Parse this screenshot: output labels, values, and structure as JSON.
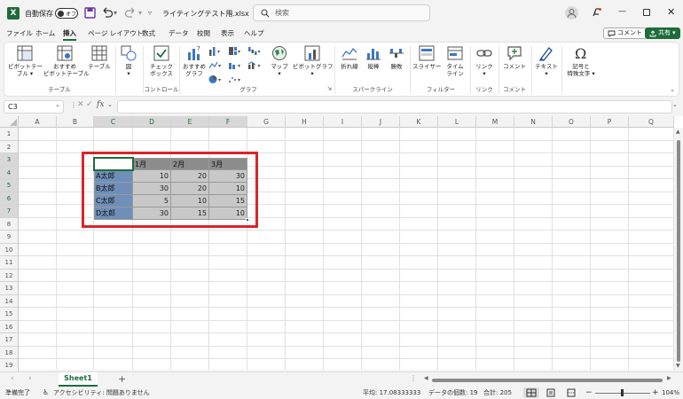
{
  "titlebar": {
    "autosave_label": "自動保存",
    "autosave_state": "オフ",
    "filename": "ライティングテスト用.xlsx",
    "search_placeholder": "検索"
  },
  "menu": {
    "items": [
      "ファイル",
      "ホーム",
      "挿入",
      "ページ レイアウト",
      "数式",
      "データ",
      "校閲",
      "表示",
      "ヘルプ"
    ],
    "active": "挿入",
    "comment_button": "コメント",
    "share_button": "共有"
  },
  "ribbon": {
    "buttons": [
      {
        "label": "ピボットテー\nブル ▾",
        "icon": "pivot-table-icon"
      },
      {
        "label": "おすすめ\nピボットテーブル",
        "icon": "recommended-pivot-icon"
      },
      {
        "label": "テーブル",
        "icon": "table-icon"
      },
      {
        "label": "図\n▾",
        "icon": "illustrations-icon"
      },
      {
        "label": "チェック\nボックス",
        "icon": "checkbox-icon"
      },
      {
        "label": "おすすめ\nグラフ",
        "icon": "recommended-chart-icon"
      },
      {
        "label": "マップ\n▾",
        "icon": "map-icon"
      },
      {
        "label": "ピボットグラフ\n▾",
        "icon": "pivot-chart-icon"
      },
      {
        "label": "折れ線",
        "icon": "sparkline-line-icon"
      },
      {
        "label": "縦棒",
        "icon": "sparkline-column-icon"
      },
      {
        "label": "勝敗",
        "icon": "sparkline-winloss-icon"
      },
      {
        "label": "スライサー",
        "icon": "slicer-icon"
      },
      {
        "label": "タイム\nライン",
        "icon": "timeline-icon"
      },
      {
        "label": "リンク\n▾",
        "icon": "link-icon"
      },
      {
        "label": "コメント",
        "icon": "comment-icon"
      },
      {
        "label": "テキスト\n▾",
        "icon": "text-icon"
      },
      {
        "label": "記号と\n特殊文字 ▾",
        "icon": "symbol-icon"
      }
    ],
    "groups": [
      "テーブル",
      "コントロール",
      "グラフ",
      "スパークライン",
      "フィルター",
      "リンク",
      "コメント"
    ]
  },
  "formula_bar": {
    "name_box": "C3",
    "formula": ""
  },
  "columns": [
    "A",
    "B",
    "C",
    "D",
    "E",
    "F",
    "G",
    "H",
    "I",
    "J",
    "K",
    "L",
    "M",
    "N",
    "O",
    "P",
    "Q"
  ],
  "rows": [
    "1",
    "2",
    "3",
    "4",
    "5",
    "6",
    "7",
    "8",
    "9",
    "10",
    "11",
    "12",
    "13",
    "14",
    "15",
    "16",
    "17",
    "18",
    "19"
  ],
  "table": {
    "header": [
      "",
      "1月",
      "2月",
      "3月"
    ],
    "rows": [
      {
        "name": "A太郎",
        "values": [
          "10",
          "20",
          "30"
        ]
      },
      {
        "name": "B太郎",
        "values": [
          "30",
          "20",
          "10"
        ]
      },
      {
        "name": "C太郎",
        "values": [
          "5",
          "10",
          "15"
        ]
      },
      {
        "name": "D太郎",
        "values": [
          "30",
          "15",
          "10"
        ]
      }
    ]
  },
  "sheets": {
    "active": "Sheet1",
    "add": "+"
  },
  "status": {
    "ready": "準備完了",
    "accessibility": "アクセシビリティ: 問題ありません",
    "average": "平均: 17.08333333",
    "count": "データの個数: 19",
    "sum": "合計: 205",
    "zoom": "104%"
  },
  "colors": {
    "excel_green": "#1d6c3a",
    "highlight_red": "#d9252a",
    "header_fill": "#8c8c8c",
    "name_fill": "#6f8fb8",
    "value_fill": "#c8c8c8"
  }
}
